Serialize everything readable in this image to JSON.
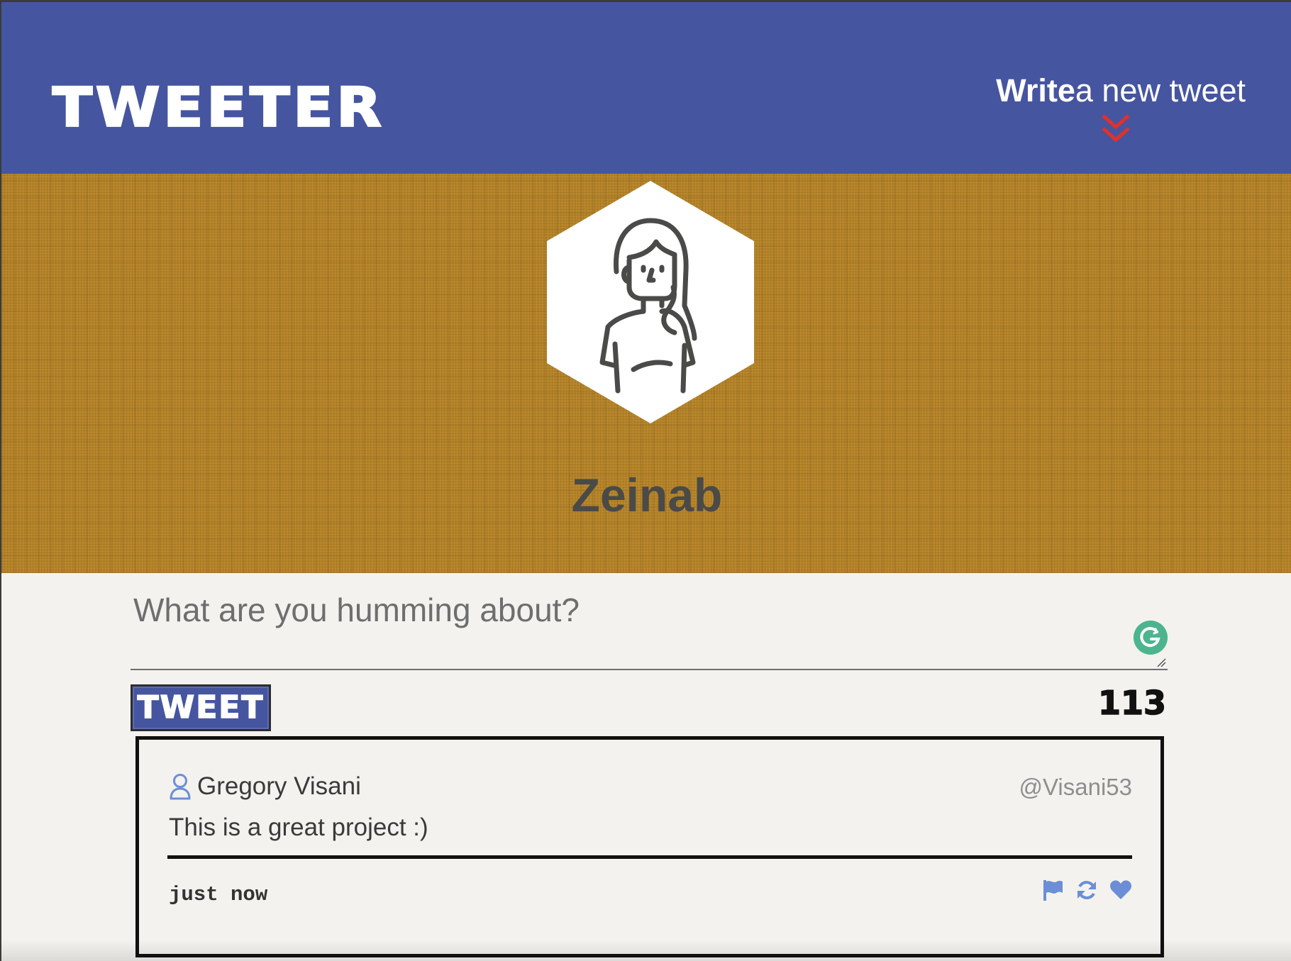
{
  "nav": {
    "brand": "TWEETER",
    "compose_bold": "Write",
    "compose_rest": "a new tweet",
    "compose_icon": "double-chevron-down-icon",
    "accent_color": "#e0312b",
    "bar_color": "#4655a0"
  },
  "profile": {
    "name": "Zeinab",
    "avatar_icon": "woman-avatar-icon",
    "banner_color": "#b98526"
  },
  "composer": {
    "placeholder": "What are you humming about?",
    "value": "",
    "button_label": "TWEET",
    "char_counter": "113"
  },
  "tweets": [
    {
      "author_name": "Gregory Visani",
      "handle": "@Visani53",
      "content": "This is a great project :)",
      "timestamp": "just now",
      "actions": [
        "flag-icon",
        "retweet-icon",
        "heart-icon"
      ],
      "icon_color": "#6b8ed6"
    }
  ]
}
